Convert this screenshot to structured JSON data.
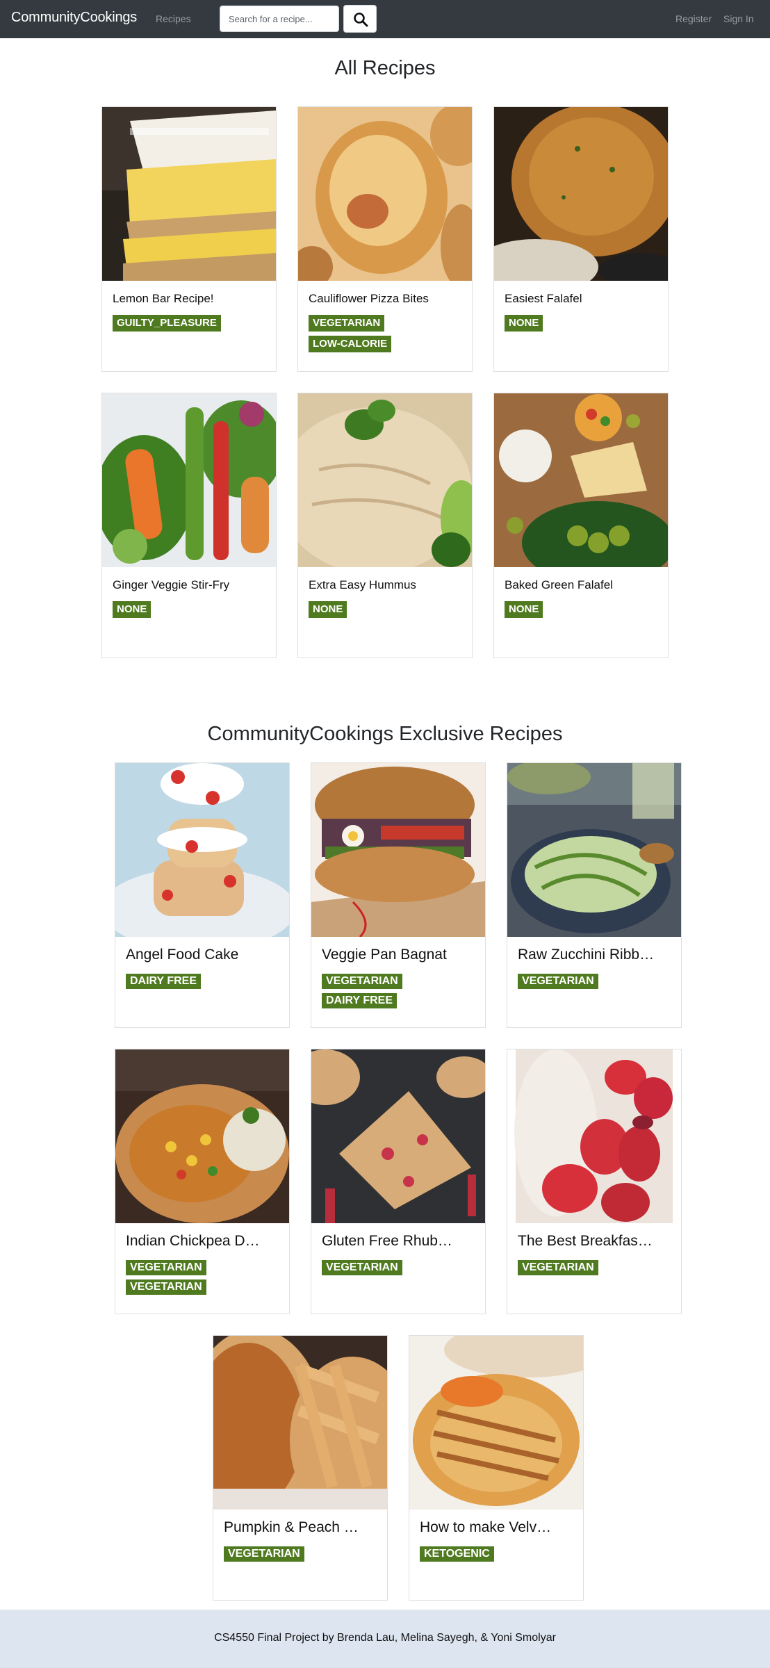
{
  "nav": {
    "brand": "CommunityCookings",
    "recipes": "Recipes",
    "search_placeholder": "Search for a recipe...",
    "register": "Register",
    "sign_in": "Sign In",
    "search_icon": "search-icon"
  },
  "sections": {
    "all_recipes_title": "All Recipes",
    "exclusive_title": "CommunityCookings Exclusive Recipes"
  },
  "all_recipes": [
    {
      "title": "Lemon Bar Recipe!",
      "tags": [
        "GUILTY_PLEASURE"
      ]
    },
    {
      "title": "Cauliflower Pizza Bites",
      "tags": [
        "VEGETARIAN",
        "LOW-CALORIE"
      ]
    },
    {
      "title": "Easiest Falafel",
      "tags": [
        "NONE"
      ]
    },
    {
      "title": "Ginger Veggie Stir-Fry",
      "tags": [
        "NONE"
      ]
    },
    {
      "title": "Extra Easy Hummus",
      "tags": [
        "NONE"
      ]
    },
    {
      "title": "Baked Green Falafel",
      "tags": [
        "NONE"
      ]
    }
  ],
  "exclusive_recipes": [
    {
      "title": "Angel Food Cake",
      "tags": [
        "DAIRY FREE"
      ]
    },
    {
      "title": "Veggie Pan Bagnat",
      "tags": [
        "VEGETARIAN",
        "DAIRY FREE"
      ]
    },
    {
      "title": "Raw Zucchini Ribb…",
      "tags": [
        "VEGETARIAN"
      ]
    },
    {
      "title": "Indian Chickpea D…",
      "tags": [
        "VEGETARIAN",
        "VEGETARIAN"
      ]
    },
    {
      "title": "Gluten Free Rhub…",
      "tags": [
        "VEGETARIAN"
      ]
    },
    {
      "title": "The Best Breakfas…",
      "tags": [
        "VEGETARIAN"
      ]
    },
    {
      "title": "Pumpkin & Peach …",
      "tags": [
        "VEGETARIAN"
      ]
    },
    {
      "title": "How to make Velv…",
      "tags": [
        "KETOGENIC"
      ]
    }
  ],
  "footer": {
    "text": "CS4550 Final Project by Brenda Lau, Melina Sayegh, & Yoni Smolyar"
  },
  "colors": {
    "navbar": "#343a40",
    "tag": "#4f7a1f",
    "footer": "#dde5f0"
  }
}
